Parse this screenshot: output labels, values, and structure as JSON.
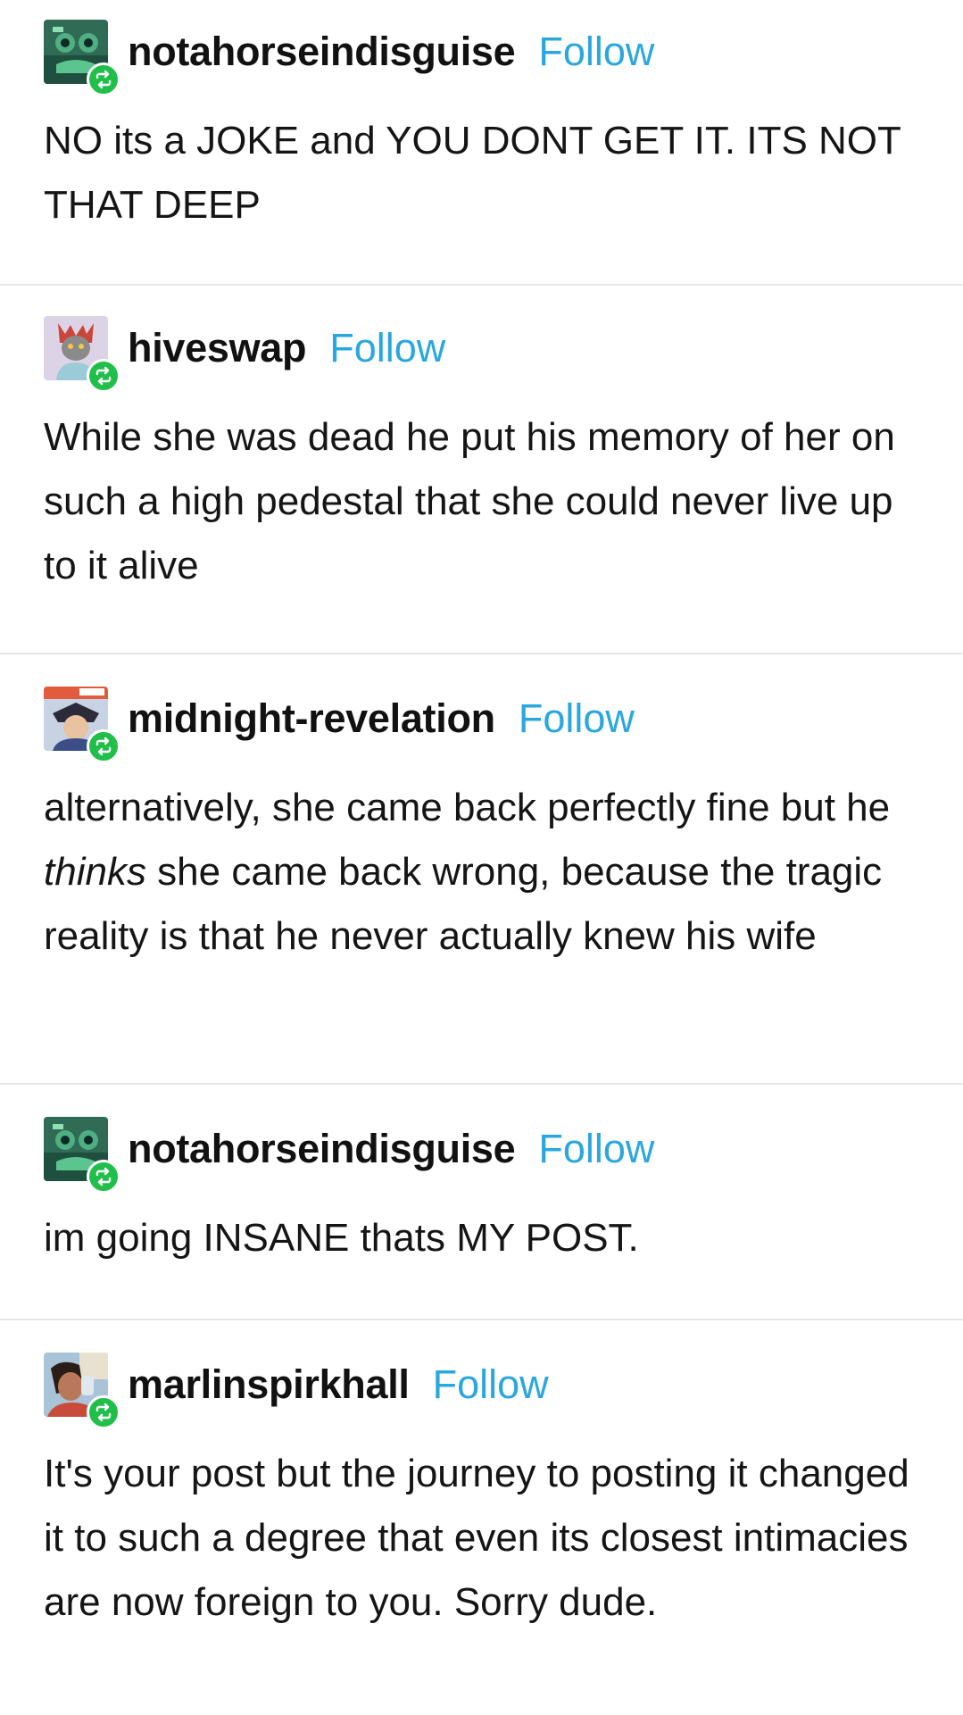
{
  "follow_label": "Follow",
  "colors": {
    "follow": "#2aa7de",
    "reblog_badge": "#1fbf4a",
    "divider": "#e6e6e6"
  },
  "posts": [
    {
      "username": "notahorseindisguise",
      "avatar_icon": "green-creature-avatar",
      "body": "NO its a JOKE and YOU DONT GET IT. ITS NOT THAT DEEP"
    },
    {
      "username": "hiveswap",
      "avatar_icon": "troll-character-avatar",
      "body": "While she was dead he put his memory of her on such a high pedestal that she could never live up to it alive"
    },
    {
      "username": "midnight-revelation",
      "avatar_icon": "anime-character-avatar",
      "body_parts": [
        "alternatively, she came back perfectly fine but he ",
        "thinks",
        " she came back wrong, because the tragic reality is that he never actually knew his wife"
      ]
    },
    {
      "username": "notahorseindisguise",
      "avatar_icon": "green-creature-avatar",
      "body": "im going INSANE thats MY POST."
    },
    {
      "username": "marlinspirkhall",
      "avatar_icon": "comic-character-avatar",
      "body": "It's your post but the journey to posting it changed it to such a degree that even its closest intimacies are now foreign to you. Sorry dude."
    }
  ]
}
